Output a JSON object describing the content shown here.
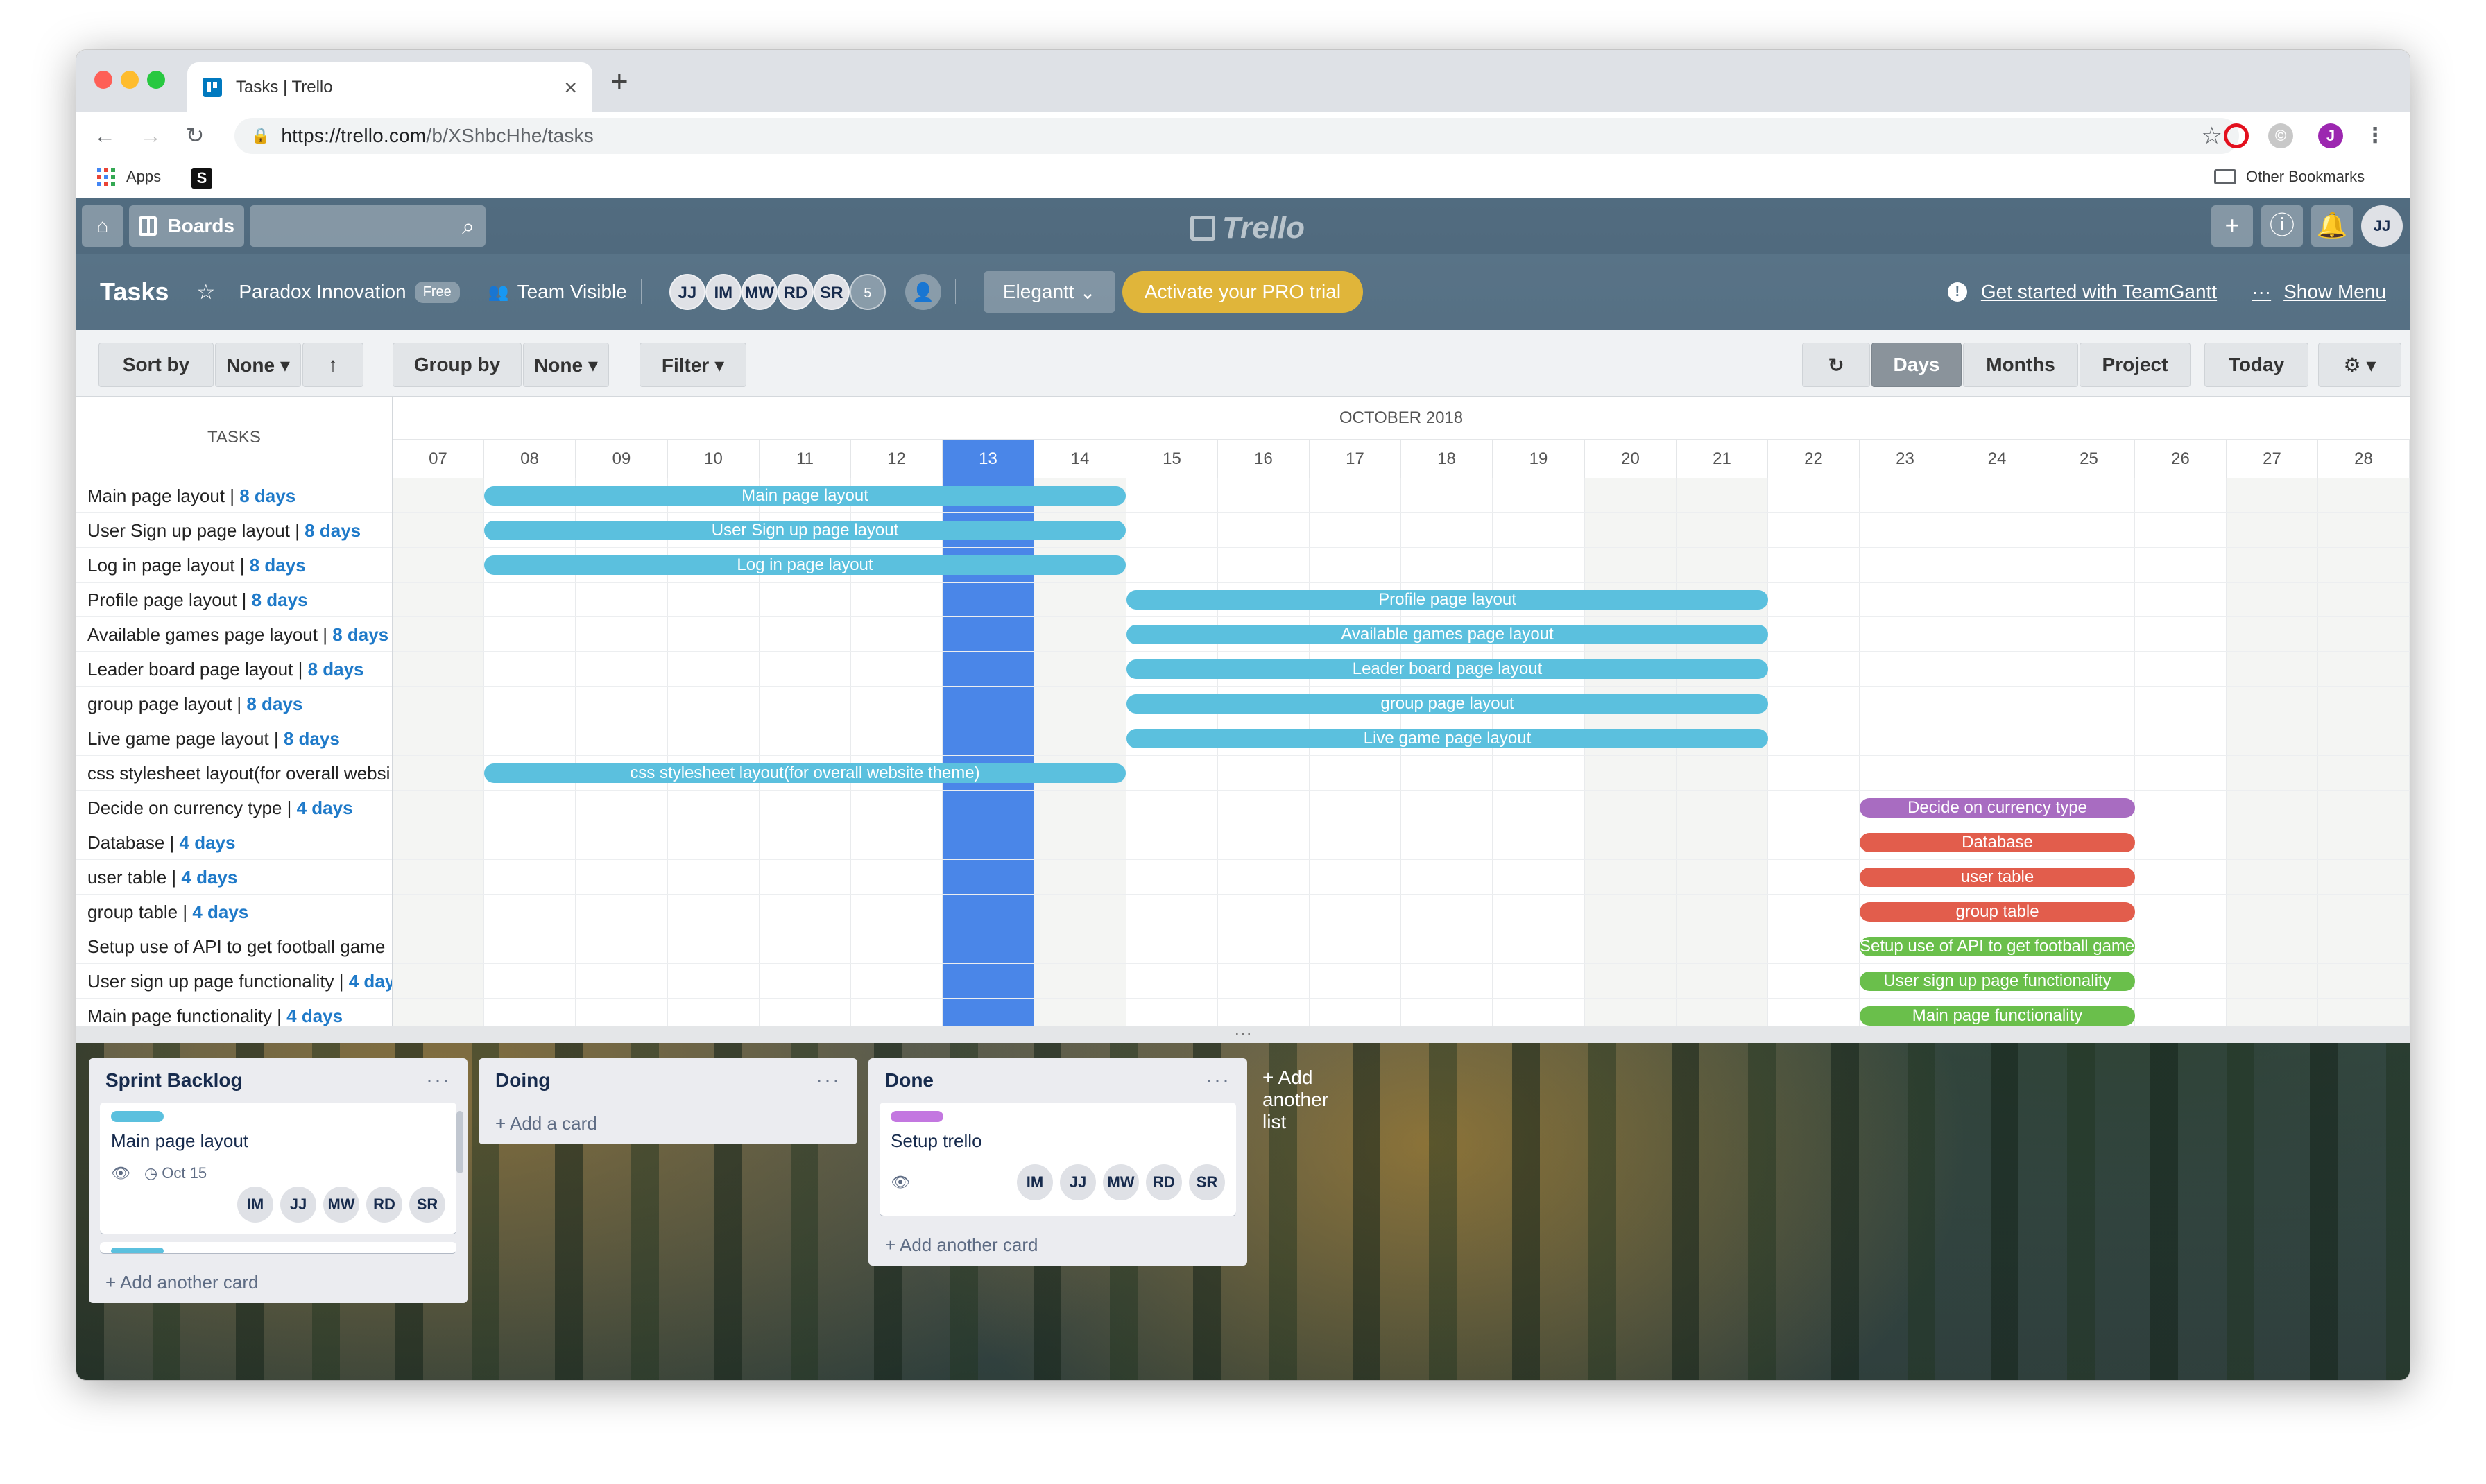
{
  "browser": {
    "tab_title": "Tasks | Trello",
    "url_host": "https://trello.com",
    "url_path": "/b/XShbcHhe/tasks",
    "bookmarks": {
      "apps": "Apps",
      "other": "Other Bookmarks"
    },
    "profile_initial": "J"
  },
  "header": {
    "boards_label": "Boards",
    "logo": "Trello",
    "avatar": "JJ"
  },
  "board": {
    "title": "Tasks",
    "team": "Paradox Innovation",
    "team_badge": "Free",
    "visibility": "Team Visible",
    "members": [
      "JJ",
      "IM",
      "MW",
      "RD",
      "SR"
    ],
    "member_count": "5",
    "powerup": "Elegantt",
    "pro_button": "Activate your PRO trial",
    "get_started": "Get started with TeamGantt",
    "show_menu": "Show Menu"
  },
  "gantt_toolbar": {
    "sort_by": "Sort by",
    "sort_value": "None ▾",
    "group_by": "Group by",
    "group_value": "None ▾",
    "filter": "Filter ▾",
    "days": "Days",
    "months": "Months",
    "project": "Project",
    "today": "Today"
  },
  "gantt": {
    "tasks_header": "TASKS",
    "month": "OCTOBER 2018",
    "days": [
      "07",
      "08",
      "09",
      "10",
      "11",
      "12",
      "13",
      "14",
      "15",
      "16",
      "17",
      "18",
      "19",
      "20",
      "21",
      "22",
      "23",
      "24",
      "25",
      "26",
      "27",
      "28"
    ],
    "today": "13",
    "tasks": [
      {
        "name": "Main page layout",
        "dur": "8 days"
      },
      {
        "name": "User Sign up page layout",
        "dur": "8 days"
      },
      {
        "name": "Log in page layout",
        "dur": "8 days"
      },
      {
        "name": "Profile page layout",
        "dur": "8 days"
      },
      {
        "name": "Available games page layout",
        "dur": "8 days"
      },
      {
        "name": "Leader board page layout",
        "dur": "8 days"
      },
      {
        "name": "group page layout",
        "dur": "8 days"
      },
      {
        "name": "Live game page layout",
        "dur": "8 days"
      },
      {
        "name": "css stylesheet layout(for overall websi",
        "dur": ""
      },
      {
        "name": "Decide on currency type",
        "dur": "4 days"
      },
      {
        "name": "Database",
        "dur": "4 days"
      },
      {
        "name": "user table",
        "dur": "4 days"
      },
      {
        "name": "group table",
        "dur": "4 days"
      },
      {
        "name": "Setup use of API to get football game",
        "dur": ""
      },
      {
        "name": "User sign up page functionality",
        "dur": "4 day"
      },
      {
        "name": "Main page functionality",
        "dur": "4 days"
      }
    ],
    "bars": [
      {
        "label": "Main page layout",
        "start": "08",
        "end": "15",
        "color": "#5bc0de"
      },
      {
        "label": "User Sign up page layout",
        "start": "08",
        "end": "15",
        "color": "#5bc0de"
      },
      {
        "label": "Log in page layout",
        "start": "08",
        "end": "15",
        "color": "#5bc0de"
      },
      {
        "label": "Profile page layout",
        "start": "15",
        "end": "22",
        "color": "#5bc0de"
      },
      {
        "label": "Available games page layout",
        "start": "15",
        "end": "22",
        "color": "#5bc0de"
      },
      {
        "label": "Leader board page layout",
        "start": "15",
        "end": "22",
        "color": "#5bc0de"
      },
      {
        "label": "group page layout",
        "start": "15",
        "end": "22",
        "color": "#5bc0de"
      },
      {
        "label": "Live game page layout",
        "start": "15",
        "end": "22",
        "color": "#5bc0de"
      },
      {
        "label": "css stylesheet layout(for overall website theme)",
        "start": "08",
        "end": "15",
        "color": "#5bc0de"
      },
      {
        "label": "Decide on currency type",
        "start": "23",
        "end": "26",
        "color": "#a86cc1"
      },
      {
        "label": "Database",
        "start": "23",
        "end": "26",
        "color": "#e25d4c"
      },
      {
        "label": "user table",
        "start": "23",
        "end": "26",
        "color": "#e25d4c"
      },
      {
        "label": "group table",
        "start": "23",
        "end": "26",
        "color": "#e25d4c"
      },
      {
        "label": "Setup use of API to get football game data",
        "start": "23",
        "end": "26",
        "color": "#6abf4b"
      },
      {
        "label": "User sign up page functionality",
        "start": "23",
        "end": "26",
        "color": "#6abf4b"
      },
      {
        "label": "Main page functionality",
        "start": "23",
        "end": "26",
        "color": "#6abf4b"
      }
    ]
  },
  "lists": {
    "backlog": {
      "title": "Sprint Backlog",
      "card_title": "Main page layout",
      "card_date": "Oct 15",
      "card_label_color": "#5bc0de",
      "members": [
        "IM",
        "JJ",
        "MW",
        "RD",
        "SR"
      ],
      "add": "+ Add another card"
    },
    "doing": {
      "title": "Doing",
      "add": "+ Add a card"
    },
    "done": {
      "title": "Done",
      "card_title": "Setup trello",
      "card_label_color": "#c377e0",
      "members": [
        "IM",
        "JJ",
        "MW",
        "RD",
        "SR"
      ],
      "add": "+ Add another card"
    },
    "add_list": "+ Add another list"
  }
}
